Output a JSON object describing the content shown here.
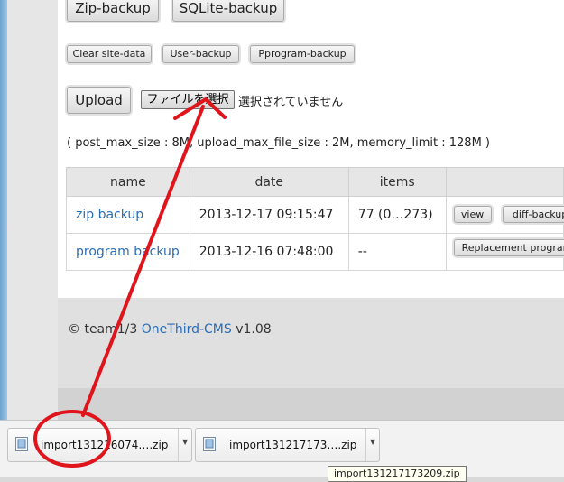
{
  "buttons": {
    "zip_backup": "Zip-backup",
    "sqlite_backup": "SQLite-backup",
    "clear_site_data": "Clear site-data",
    "user_backup": "User-backup",
    "program_backup": "Pprogram-backup",
    "upload": "Upload"
  },
  "file_input": {
    "button_label": "ファイルを選択",
    "status": "選択されていません"
  },
  "limits_text": "( post_max_size : 8M, upload_max_file_size : 2M, memory_limit : 128M )",
  "table": {
    "headers": [
      "name",
      "date",
      "items",
      ""
    ],
    "rows": [
      {
        "name": "zip backup",
        "date": "2013-12-17 09:15:47",
        "items": "77 (0…273)",
        "actions": [
          "view",
          "diff-backup"
        ]
      },
      {
        "name": "program backup",
        "date": "2013-12-16 07:48:00",
        "items": "--",
        "actions": [
          "Replacement program"
        ]
      }
    ]
  },
  "footer": {
    "prefix": "© team1/3",
    "link": "OneThird-CMS",
    "version": "v1.08"
  },
  "downloads": [
    {
      "name": "import131216074….zip",
      "icon": "zip-file-icon"
    },
    {
      "name": "import131217173….zip",
      "icon": "zip-file-icon"
    }
  ],
  "tooltip": "import131217173209.zip",
  "colors": {
    "link": "#2a6db5",
    "annotation": "#e0141b"
  }
}
